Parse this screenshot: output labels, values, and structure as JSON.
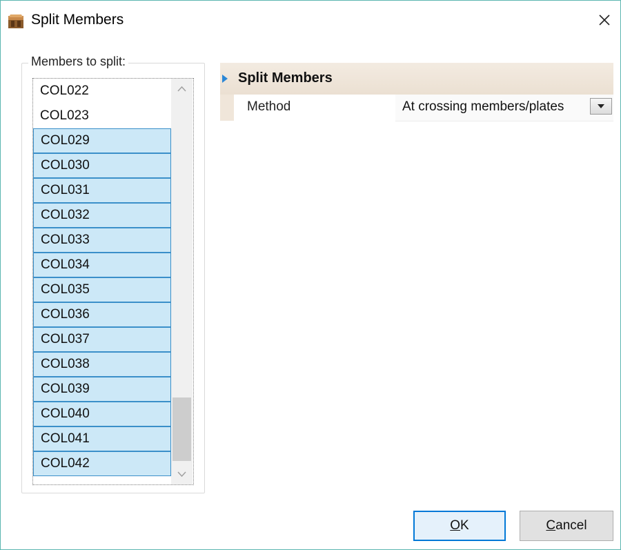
{
  "window": {
    "title": "Split Members",
    "close_label": "✕"
  },
  "members_group": {
    "legend": "Members to split:",
    "items": [
      {
        "label": "COL022",
        "selected": false
      },
      {
        "label": "COL023",
        "selected": false
      },
      {
        "label": "COL029",
        "selected": true
      },
      {
        "label": "COL030",
        "selected": true
      },
      {
        "label": "COL031",
        "selected": true
      },
      {
        "label": "COL032",
        "selected": true
      },
      {
        "label": "COL033",
        "selected": true
      },
      {
        "label": "COL034",
        "selected": true
      },
      {
        "label": "COL035",
        "selected": true
      },
      {
        "label": "COL036",
        "selected": true
      },
      {
        "label": "COL037",
        "selected": true
      },
      {
        "label": "COL038",
        "selected": true
      },
      {
        "label": "COL039",
        "selected": true
      },
      {
        "label": "COL040",
        "selected": true
      },
      {
        "label": "COL041",
        "selected": true
      },
      {
        "label": "COL042",
        "selected": true
      }
    ]
  },
  "property_grid": {
    "category": "Split Members",
    "rows": [
      {
        "label": "Method",
        "value": "At crossing members/plates"
      }
    ]
  },
  "buttons": {
    "ok_mnemonic": "O",
    "ok_rest": "K",
    "cancel_mnemonic": "C",
    "cancel_rest": "ancel"
  },
  "colors": {
    "selection_fill": "#cce8f7",
    "selection_border": "#3a8fc9",
    "default_button_border": "#0078d7",
    "window_border": "#5bb5b0",
    "category_band": "#efe5d8"
  },
  "icons": {
    "app": "split-members-app-icon",
    "close": "close-icon",
    "expander": "category-expanded-triangle-icon",
    "dropdown": "dropdown-arrow-icon",
    "scroll_up": "scroll-up-arrow-icon",
    "scroll_down": "scroll-down-arrow-icon"
  }
}
